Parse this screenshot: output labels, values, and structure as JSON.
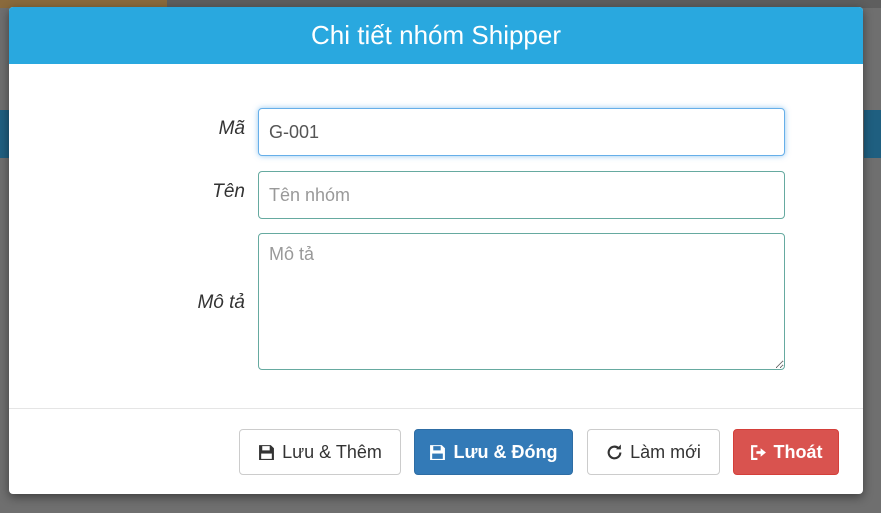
{
  "dialog": {
    "title": "Chi tiết nhóm Shipper"
  },
  "form": {
    "code": {
      "label": "Mã",
      "value": "G-001",
      "placeholder": ""
    },
    "name": {
      "label": "Tên",
      "value": "",
      "placeholder": "Tên nhóm"
    },
    "description": {
      "label": "Mô tả",
      "value": "",
      "placeholder": "Mô tả"
    }
  },
  "buttons": {
    "save_add": {
      "label": "Lưu & Thêm",
      "icon": "floppy-disk-icon"
    },
    "save_close": {
      "label": "Lưu & Đóng",
      "icon": "floppy-disk-icon"
    },
    "refresh": {
      "label": "Làm mới",
      "icon": "refresh-icon"
    },
    "exit": {
      "label": "Thoát",
      "icon": "sign-out-icon"
    }
  },
  "colors": {
    "header": "#29a8df",
    "primary": "#337ab7",
    "danger": "#d9534f",
    "input_border": "#66aaa0"
  }
}
